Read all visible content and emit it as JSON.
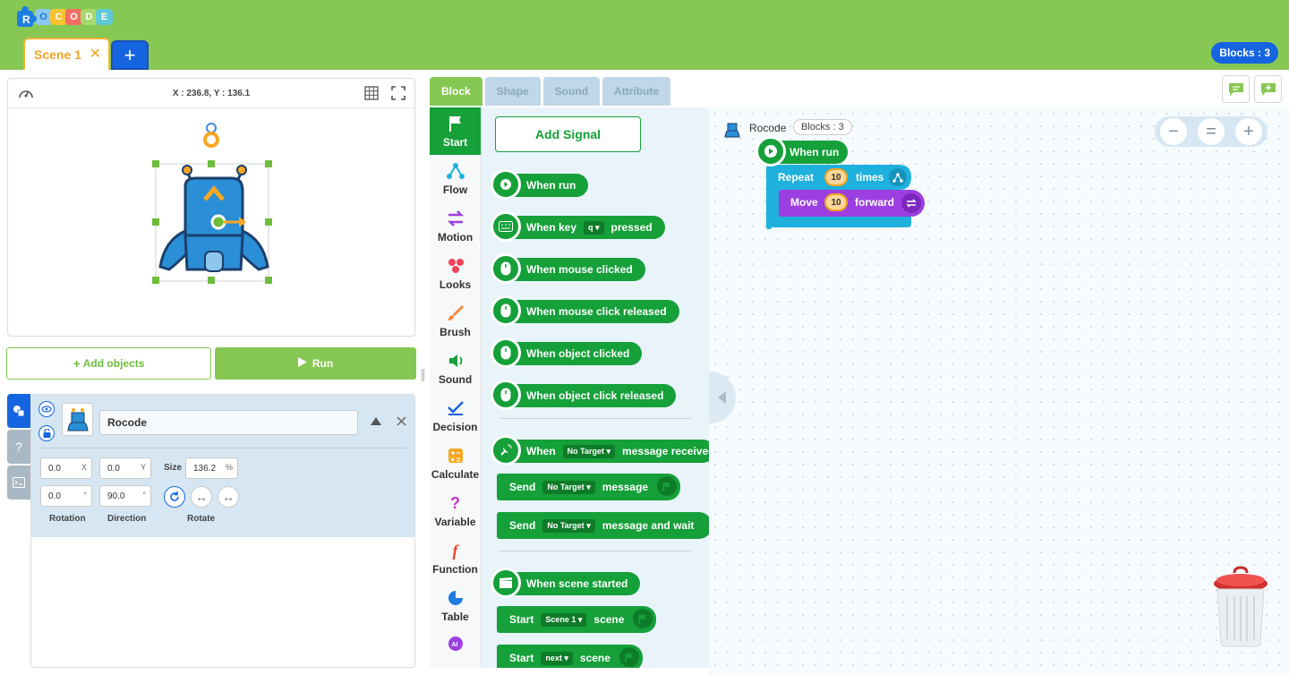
{
  "app": {
    "logo_letters": [
      "O",
      "C",
      "O",
      "D",
      "E"
    ]
  },
  "scene_tabs": [
    {
      "label": "Scene 1",
      "close": "✕"
    }
  ],
  "add_scene_label": "+",
  "blocks_badge": "Blocks : 3",
  "stage": {
    "coords": "X : 236.8, Y : 136.1"
  },
  "buttons": {
    "add_objects": "Add objects",
    "run": "Run"
  },
  "object": {
    "name": "Rocode",
    "x": "0.0",
    "x_unit": "X",
    "y": "0.0",
    "y_unit": "Y",
    "size_label": "Size",
    "size": "136.2",
    "size_unit": "%",
    "rotation": "0.0",
    "rotation_unit": "°",
    "direction": "90.0",
    "direction_unit": "°",
    "rotation_label": "Rotation",
    "direction_label": "Direction",
    "rotate_label": "Rotate"
  },
  "side_tabs": {
    "help": "?"
  },
  "editor_tabs": [
    "Block",
    "Shape",
    "Sound",
    "Attribute"
  ],
  "categories": [
    "Start",
    "Flow",
    "Motion",
    "Looks",
    "Brush",
    "Sound",
    "Decision",
    "Calculate",
    "Variable",
    "Function",
    "Table",
    "AI"
  ],
  "palette": {
    "add_signal": "Add Signal",
    "when_run": "When run",
    "when_key": "When key",
    "key_value": "q",
    "pressed": "pressed",
    "mouse_clicked": "When mouse clicked",
    "mouse_released": "When mouse click released",
    "object_clicked": "When object clicked",
    "object_released": "When object click released",
    "when": "When",
    "no_target": "No Target",
    "message_received": "message received",
    "send": "Send",
    "message": "message",
    "message_wait": "message and wait",
    "scene_started": "When scene started",
    "start": "Start",
    "scene_value": "Scene 1",
    "scene": "scene",
    "next_value": "next"
  },
  "workspace": {
    "sprite_name": "Rocode",
    "blocks_label": "Blocks : 3",
    "when_run": "When run",
    "repeat": "Repeat",
    "repeat_value": "10",
    "times": "times",
    "move": "Move",
    "move_value": "10",
    "forward": "forward"
  },
  "zoom": {
    "minus": "−",
    "reset": "=",
    "plus": "+"
  },
  "colors": {
    "topbar": "#86c853",
    "accent_blue": "#1565e0",
    "block_green": "#15a039",
    "flow_cyan": "#1fb1de",
    "motion_purple": "#9c3fe0",
    "orange": "#f0a323"
  }
}
